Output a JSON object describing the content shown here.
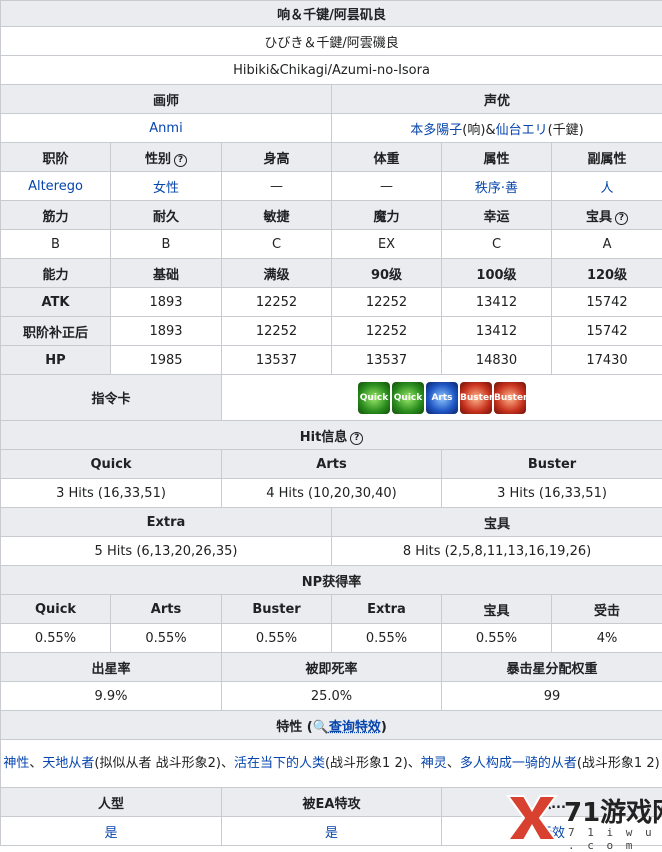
{
  "header": {
    "name_cn": "响＆千键/阿昙矶良",
    "name_jp": "ひびき＆千鍵/阿雲磯良",
    "name_en": "Hibiki&Chikagi/Azumi-no-Isora"
  },
  "illustrator": {
    "label": "画师",
    "value": "Anmi"
  },
  "voice": {
    "label": "声优",
    "actor1": "本多陽子",
    "part1": "(响)&",
    "actor2": "仙台エリ",
    "part2": "(千鍵)"
  },
  "attr_head": [
    "职阶",
    "性别",
    "身高",
    "体重",
    "属性",
    "副属性"
  ],
  "attr_vals": [
    "Alterego",
    "女性",
    "—",
    "—",
    "秩序·善",
    "人"
  ],
  "param_head": [
    "筋力",
    "耐久",
    "敏捷",
    "魔力",
    "幸运",
    "宝具"
  ],
  "param_vals": [
    "B",
    "B",
    "C",
    "EX",
    "C",
    "A"
  ],
  "stat_head": [
    "能力",
    "基础",
    "满级",
    "90级",
    "100级",
    "120级"
  ],
  "stats": [
    {
      "label": "ATK",
      "values": [
        "1893",
        "12252",
        "12252",
        "13412",
        "15742"
      ]
    },
    {
      "label": "职阶补正后",
      "values": [
        "1893",
        "12252",
        "12252",
        "13412",
        "15742"
      ]
    },
    {
      "label": "HP",
      "values": [
        "1985",
        "13537",
        "13537",
        "14830",
        "17430"
      ]
    }
  ],
  "command_cards": {
    "label": "指令卡",
    "cards": [
      {
        "type": "quick",
        "label": "Quick"
      },
      {
        "type": "quick",
        "label": "Quick"
      },
      {
        "type": "arts",
        "label": "Arts"
      },
      {
        "type": "buster",
        "label": "Buster"
      },
      {
        "type": "buster",
        "label": "Buster"
      }
    ]
  },
  "hit_info": {
    "title": "Hit信息",
    "row1_head": [
      "Quick",
      "Arts",
      "Buster"
    ],
    "row1_vals": [
      "3 Hits (16,33,51)",
      "4 Hits (10,20,30,40)",
      "3 Hits (16,33,51)"
    ],
    "row2_head": [
      "Extra",
      "宝具"
    ],
    "row2_vals": [
      "5 Hits (6,13,20,26,35)",
      "8 Hits (2,5,8,11,13,16,19,26)"
    ]
  },
  "np": {
    "title": "NP获得率",
    "head": [
      "Quick",
      "Arts",
      "Buster",
      "Extra",
      "宝具",
      "受击"
    ],
    "vals": [
      "0.55%",
      "0.55%",
      "0.55%",
      "0.55%",
      "0.55%",
      "4%"
    ]
  },
  "stars": {
    "head": [
      "出星率",
      "被即死率",
      "暴击星分配权重"
    ],
    "vals": [
      "9.9%",
      "25.0%",
      "99"
    ]
  },
  "traits": {
    "title": "特性",
    "search": "查询特效",
    "t1": "神性",
    "t2": "天地从者",
    "t3": "(拟似从者 战斗形象2)、",
    "t4": "活在当下的人类",
    "t5": "(战斗形象1 2)、",
    "t6": "神灵",
    "t7": "多人构成一骑的从者",
    "t8": "(战斗形象1 2)"
  },
  "last": {
    "head": [
      "人型",
      "被EA特攻",
      "独..."
    ],
    "vals": [
      "是",
      "是",
      "无效"
    ]
  },
  "watermark": {
    "brand": "71游戏网",
    "url": "7 1 i w u . c o m"
  }
}
